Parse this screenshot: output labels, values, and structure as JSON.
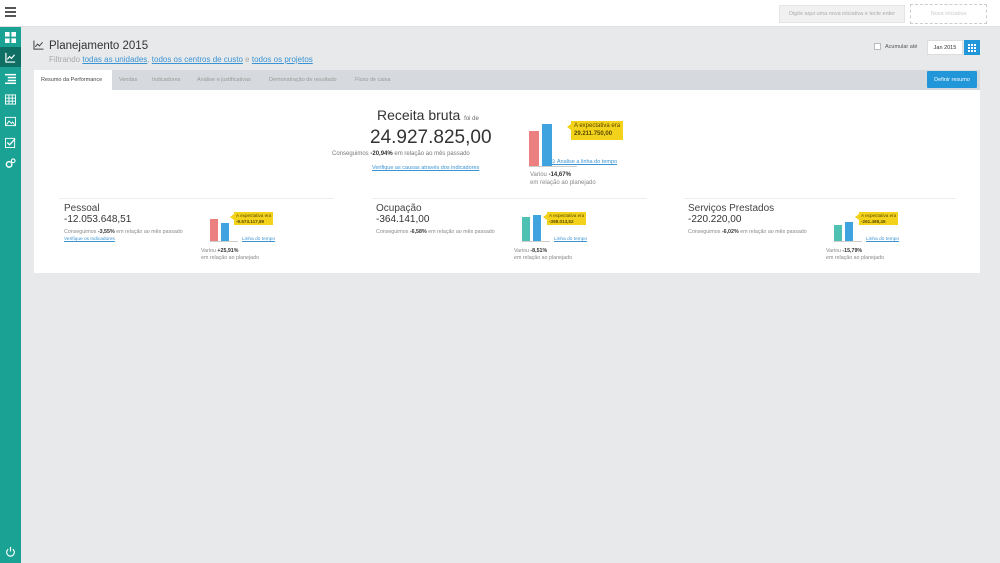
{
  "topbar": {
    "initiative_placeholder": "Digite aqui uma nova iniciativa e tecle enter",
    "new_button": "Nova iniciativa"
  },
  "header": {
    "title": "Planejamento 2015",
    "filter_prefix": "Filtrando",
    "units_link": "todas as unidades",
    "sep1": ",",
    "cost_link": "todos os centros de custo",
    "sep2": "e",
    "projects_link": "todos os projetos",
    "accumulate_label": "Acumular até",
    "date": "Jan 2015"
  },
  "tabs": [
    "Resumo da Performance",
    "Vendas",
    "Indicadores",
    "Análise e justificativas",
    "Demonstração de resultado",
    "Fluxo de caixa"
  ],
  "define_summary_button": "Definir resumo",
  "main": {
    "title": "Receita bruta",
    "title_suffix": "foi de",
    "value": "24.927.825,00",
    "achieved_prefix": "Conseguimos",
    "achieved_value": "-20,94%",
    "achieved_suffix": "em relação ao mês passado",
    "causes_link": "Verifique as causas através dos indicadores",
    "expectation_label": "A expectativa era",
    "expectation_value": "29.211.750,00",
    "timeline_link": "Analise a linha do tempo",
    "varied_prefix": "Variou",
    "varied_value": "-14,67%",
    "varied_suffix": "em relação ao planejado",
    "bar_levels": [
      0.83,
      1.0
    ]
  },
  "cards": [
    {
      "name": "Pessoal",
      "value": "-12.053.648,51",
      "achieved_prefix": "Conseguimos",
      "achieved_value": "-3,55%",
      "achieved_suffix": "em relação ao mês passado",
      "indicators_link": "Verifique os indicadores",
      "expectation_label": "A expectativa era",
      "expectation_value": "-9.573.117,89",
      "timeline_link": "Linha do tempo",
      "varied_prefix": "Variou",
      "varied_value": "+25,91%",
      "varied_suffix": "em relação ao planejado",
      "bar_levels": [
        1.0,
        0.8
      ],
      "bar_colors": [
        "#ec8080",
        "#3fa3e0"
      ]
    },
    {
      "name": "Ocupação",
      "value": "-364.141,00",
      "achieved_prefix": "Conseguimos",
      "achieved_value": "-6,58%",
      "achieved_suffix": "em relação ao mês passado",
      "indicators_link": "",
      "expectation_label": "A expectativa era",
      "expectation_value": "-398.013,52",
      "timeline_link": "Linha do tempo",
      "varied_prefix": "Variou",
      "varied_value": "-8,51%",
      "varied_suffix": "em relação ao planejado",
      "bar_levels": [
        0.92,
        1.0
      ],
      "bar_colors": [
        "#4fc1b3",
        "#3fa3e0"
      ]
    },
    {
      "name": "Serviços Prestados",
      "value": "-220.220,00",
      "achieved_prefix": "Conseguimos",
      "achieved_value": "-6,02%",
      "achieved_suffix": "em relação ao mês passado",
      "indicators_link": "",
      "expectation_label": "A expectativa era",
      "expectation_value": "-261.498,45",
      "timeline_link": "Linha do tempo",
      "varied_prefix": "Variou",
      "varied_value": "-15,79%",
      "varied_suffix": "em relação ao planejado",
      "bar_levels": [
        0.83,
        1.0
      ],
      "bar_colors": [
        "#4fc1b3",
        "#3fa3e0"
      ]
    }
  ],
  "colors": {
    "sidebar": "#1aa394",
    "sidebar_active": "#0f6f64",
    "accent": "#2196d8",
    "actual_bar": "#ec8080",
    "planned_bar": "#3fa3e0",
    "tooltip": "#f2d21b"
  },
  "sidebar_icons": [
    "dashboard-icon",
    "chart-line-icon",
    "list-icon",
    "table-icon",
    "image-icon",
    "checklist-icon",
    "settings-icon"
  ],
  "power_icon": "power-icon"
}
